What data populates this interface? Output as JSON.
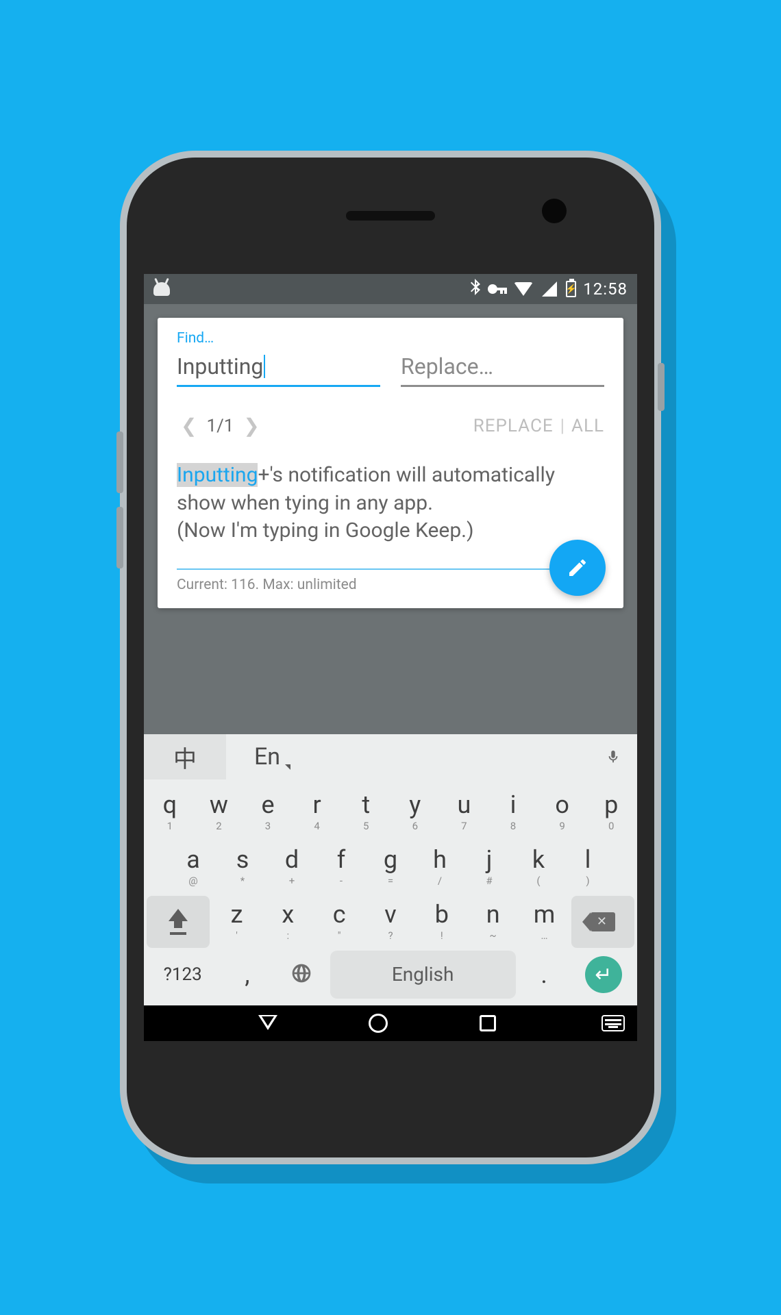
{
  "statusbar": {
    "time": "12:58"
  },
  "card": {
    "find_label": "Find…",
    "find_value": "Inputting",
    "replace_placeholder": "Replace…",
    "counter": "1/1",
    "replace_btn": "REPLACE",
    "all_btn": "ALL",
    "highlight": "Inputting",
    "body_rest": "+'s notification will automatically show when tying in any app.",
    "body_line2": "(Now I'm typing in Google Keep.)",
    "status": "Current: 116. Max: unlimited"
  },
  "keyboard": {
    "tab_cn": "中",
    "tab_en": "En",
    "row1": [
      {
        "m": "q",
        "s": "1"
      },
      {
        "m": "w",
        "s": "2"
      },
      {
        "m": "e",
        "s": "3"
      },
      {
        "m": "r",
        "s": "4"
      },
      {
        "m": "t",
        "s": "5"
      },
      {
        "m": "y",
        "s": "6"
      },
      {
        "m": "u",
        "s": "7"
      },
      {
        "m": "i",
        "s": "8"
      },
      {
        "m": "o",
        "s": "9"
      },
      {
        "m": "p",
        "s": "0"
      }
    ],
    "row2": [
      {
        "m": "a",
        "s": "@"
      },
      {
        "m": "s",
        "s": "*"
      },
      {
        "m": "d",
        "s": "+"
      },
      {
        "m": "f",
        "s": "-"
      },
      {
        "m": "g",
        "s": "="
      },
      {
        "m": "h",
        "s": "/"
      },
      {
        "m": "j",
        "s": "#"
      },
      {
        "m": "k",
        "s": "("
      },
      {
        "m": "l",
        "s": ")"
      }
    ],
    "row3": [
      {
        "m": "z",
        "s": "'"
      },
      {
        "m": "x",
        "s": ":"
      },
      {
        "m": "c",
        "s": "\""
      },
      {
        "m": "v",
        "s": "?"
      },
      {
        "m": "b",
        "s": "!"
      },
      {
        "m": "n",
        "s": "~"
      },
      {
        "m": "m",
        "s": "…"
      }
    ],
    "sym": "?123",
    "comma": ",",
    "space": "English",
    "period": "."
  }
}
